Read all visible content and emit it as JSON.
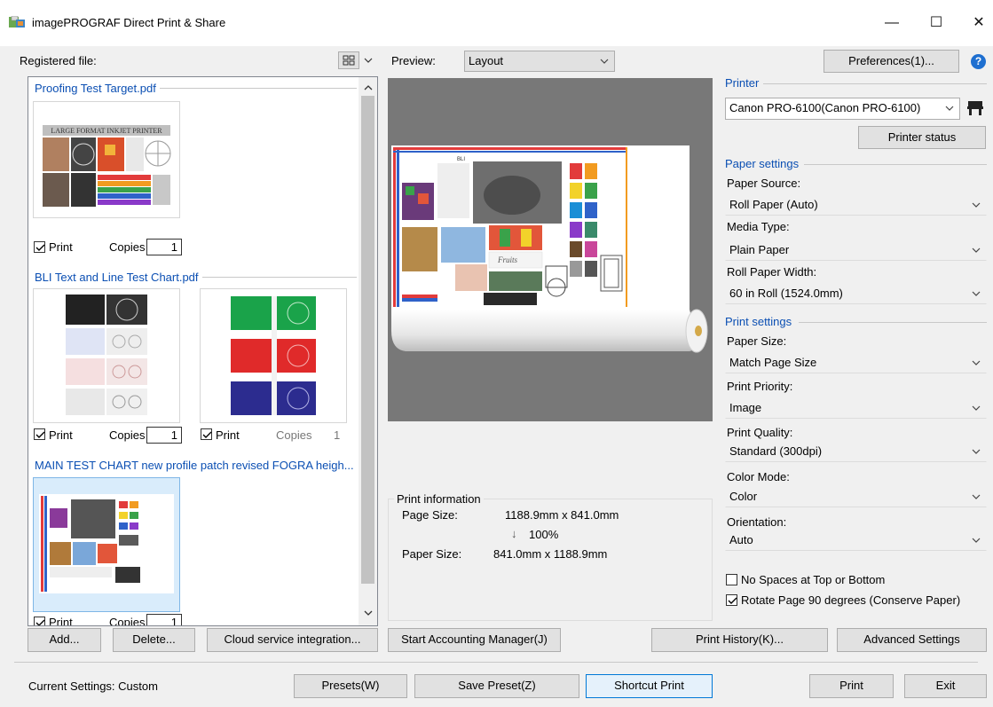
{
  "window": {
    "title": "imagePROGRAF Direct Print & Share",
    "minimize": "—",
    "maximize": "☐",
    "close": "✕"
  },
  "left": {
    "registered_label": "Registered file:",
    "files": [
      {
        "name": "Proofing Test Target.pdf",
        "print_label": "Print",
        "copies_label": "Copies",
        "copies": "1"
      },
      {
        "name": "BLI Text and Line Test Chart.pdf",
        "print_label": "Print",
        "copies_label": "Copies",
        "copies": "1",
        "copies_2": "1"
      },
      {
        "name": "MAIN TEST CHART new profile patch revised FOGRA heigh...",
        "print_label": "Print",
        "copies_label": "Copies",
        "copies": "1"
      }
    ],
    "thumb_header_text": "LARGE FORMAT INKJET PRINTER"
  },
  "preview": {
    "label": "Preview:",
    "mode": "Layout",
    "brand_text": "BLI",
    "fruits_text": "Fruits"
  },
  "print_info": {
    "legend": "Print information",
    "page_size_label": "Page Size:",
    "page_size_value": "1188.9mm x 841.0mm",
    "scale_arrow": "↓",
    "scale_value": "100%",
    "paper_size_label": "Paper Size:",
    "paper_size_value": "841.0mm x 1188.9mm"
  },
  "right": {
    "preferences_button": "Preferences(1)...",
    "help_icon": "?",
    "printer_legend": "Printer",
    "printer_selected": "Canon PRO-6100(Canon PRO-6100)",
    "printer_status_button": "Printer status",
    "paper_legend": "Paper settings",
    "paper_source_label": "Paper Source:",
    "paper_source": "Roll Paper (Auto)",
    "media_type_label": "Media Type:",
    "media_type": "Plain Paper",
    "roll_width_label": "Roll Paper Width:",
    "roll_width": "60 in Roll (1524.0mm)",
    "print_legend": "Print settings",
    "paper_size_label": "Paper Size:",
    "paper_size": "Match Page Size",
    "priority_label": "Print Priority:",
    "priority": "Image",
    "quality_label": "Print Quality:",
    "quality": "Standard (300dpi)",
    "color_mode_label": "Color Mode:",
    "color_mode": "Color",
    "orientation_label": "Orientation:",
    "orientation": "Auto",
    "no_spaces_label": "No Spaces at Top or Bottom",
    "no_spaces_checked": false,
    "rotate_label": "Rotate Page 90 degrees (Conserve Paper)",
    "rotate_checked": true
  },
  "bottom": {
    "add": "Add...",
    "delete": "Delete...",
    "cloud": "Cloud service integration...",
    "accounting": "Start Accounting Manager(J)",
    "history": "Print History(K)...",
    "advanced": "Advanced Settings",
    "current_settings": "Current Settings: Custom",
    "presets": "Presets(W)",
    "save_preset": "Save Preset(Z)",
    "shortcut_print": "Shortcut Print",
    "print": "Print",
    "exit": "Exit"
  },
  "colors": {
    "accent_blue": "#0b4fb3",
    "preview_gray": "#787878",
    "primary_border": "#0078d7"
  }
}
